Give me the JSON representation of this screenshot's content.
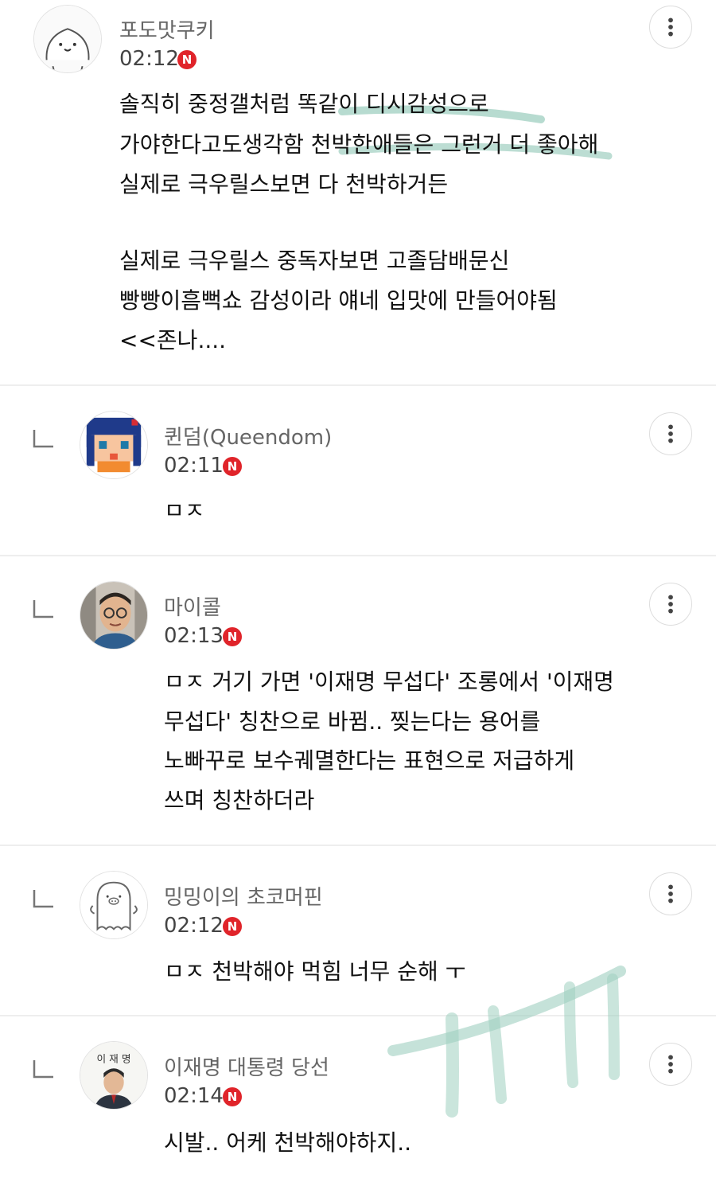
{
  "comments": [
    {
      "author": "포도맛쿠키",
      "time": "02:12",
      "badge": "N",
      "avatar_icon": "cute-face-icon",
      "is_reply": false,
      "lines": [
        "솔직히 중정갤처럼 똑같이 디시감성으로",
        "가야한다고도생각함 천박한애들은 그런거 더 좋아해",
        "실제로 극우릴스보면 다 천박하거든",
        "",
        "실제로 극우릴스 중독자보면 고졸담배문신",
        "빵빵이흠뻑쇼 감성이라 얘네 입맛에 만들어야됨",
        "<<존나...."
      ]
    },
    {
      "author": "퀸덤(Queendom)",
      "time": "02:11",
      "badge": "N",
      "avatar_icon": "pixel-anime-girl-icon",
      "is_reply": true,
      "lines": [
        "ㅁㅈ"
      ]
    },
    {
      "author": "마이콜",
      "time": "02:13",
      "badge": "N",
      "avatar_icon": "person-photo-icon",
      "is_reply": true,
      "lines": [
        "ㅁㅈ 거기 가면 '이재명 무섭다' 조롱에서 '이재명",
        "무섭다' 칭찬으로 바뀜.. 찢는다는 용어를",
        "노빠꾸로 보수궤멸한다는 표현으로 저급하게",
        "쓰며 칭찬하더라"
      ]
    },
    {
      "author": "밍밍이의 초코머핀",
      "time": "02:12",
      "badge": "N",
      "avatar_icon": "ghost-pig-icon",
      "is_reply": true,
      "lines": [
        "ㅁㅈ 천박해야 먹힘 너무 순해 ㅜ"
      ]
    },
    {
      "author": "이재명 대통령 당선",
      "time": "02:14",
      "badge": "N",
      "avatar_icon": "politician-photo-icon",
      "avatar_text": "이 재 명",
      "is_reply": true,
      "lines": [
        "시발.. 어케 천박해야하지.."
      ]
    }
  ],
  "colors": {
    "badge": "#e0242a",
    "highlight": "#9fcfc0",
    "separator": "#eeeeee"
  }
}
